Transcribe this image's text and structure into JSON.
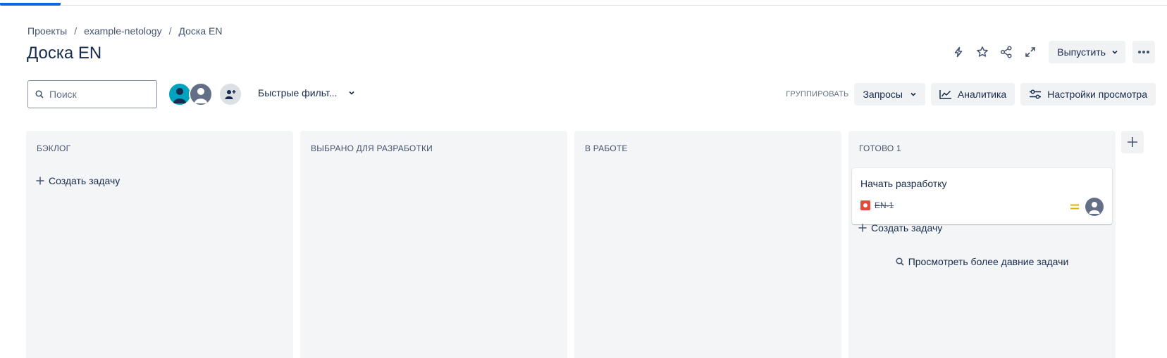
{
  "breadcrumb": [
    "Проекты",
    "example-netology",
    "Доска EN"
  ],
  "breadcrumb_separator": "/",
  "page": {
    "title": "Доска EN"
  },
  "header_actions": {
    "icons": [
      "lightning-icon",
      "star-icon",
      "share-icon",
      "expand-icon"
    ],
    "release_label": "Выпустить",
    "more_icon": "ellipsis-icon"
  },
  "toolbar": {
    "search_placeholder": "Поиск",
    "search_value": "",
    "quick_filters_label": "Быстрые фильт...",
    "group_label": "ГРУППИРОВАТЬ",
    "group_value": "Запросы",
    "analytics_label": "Аналитика",
    "view_settings_label": "Настройки просмотра"
  },
  "colors": {
    "accent": "#0c66e4",
    "column_bg": "#f4f5f7",
    "avatar_teal": "#00a3bf",
    "avatar_gray": "#626f86",
    "bug": "#e5493a",
    "priority_medium": "#e2b203"
  },
  "columns": [
    {
      "title": "БЭКЛОГ",
      "create_label": "Создать задачу"
    },
    {
      "title": "ВЫБРАНО ДЛЯ РАЗРАБОТКИ"
    },
    {
      "title": "В РАБОТЕ"
    },
    {
      "title": "ГОТОВО 1",
      "cards": [
        {
          "title": "Начать разработку",
          "key": "EN-1",
          "type_icon": "bug-icon",
          "priority_icon": "priority-medium-icon"
        }
      ],
      "create_label": "Создать задачу",
      "older_label": "Просмотреть более давние задачи"
    }
  ]
}
